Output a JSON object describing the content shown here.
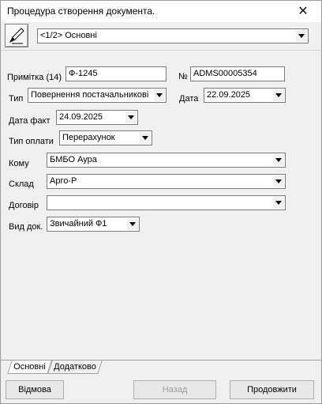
{
  "window": {
    "title": "Процедура створення документа."
  },
  "header": {
    "step_value": "<1/2> Основні"
  },
  "form": {
    "note_label": "Примітка (14)",
    "note_value": "Ф-1245",
    "number_label": "№",
    "number_value": "ADMS00005354",
    "type_label": "Тип",
    "type_value": "Повернення постачальникові",
    "date_label": "Дата",
    "date_value": "22.09.2025",
    "actual_date_label": "Дата факт",
    "actual_date_value": "24.09.2025",
    "payment_type_label": "Тип оплати",
    "payment_type_value": "Перерахунок",
    "recipient_label": "Кому",
    "recipient_value": "БМБО Аура",
    "warehouse_label": "Склад",
    "warehouse_value": "Арго-Р",
    "contract_label": "Договір",
    "contract_value": "",
    "doc_kind_label": "Вид док.",
    "doc_kind_value": "Звичайний Ф1"
  },
  "tabs": [
    {
      "label": "Основні",
      "active": true
    },
    {
      "label": "Додатково",
      "active": false
    }
  ],
  "buttons": {
    "cancel": "Відмова",
    "back": "Назад",
    "next": "Продовжити"
  }
}
